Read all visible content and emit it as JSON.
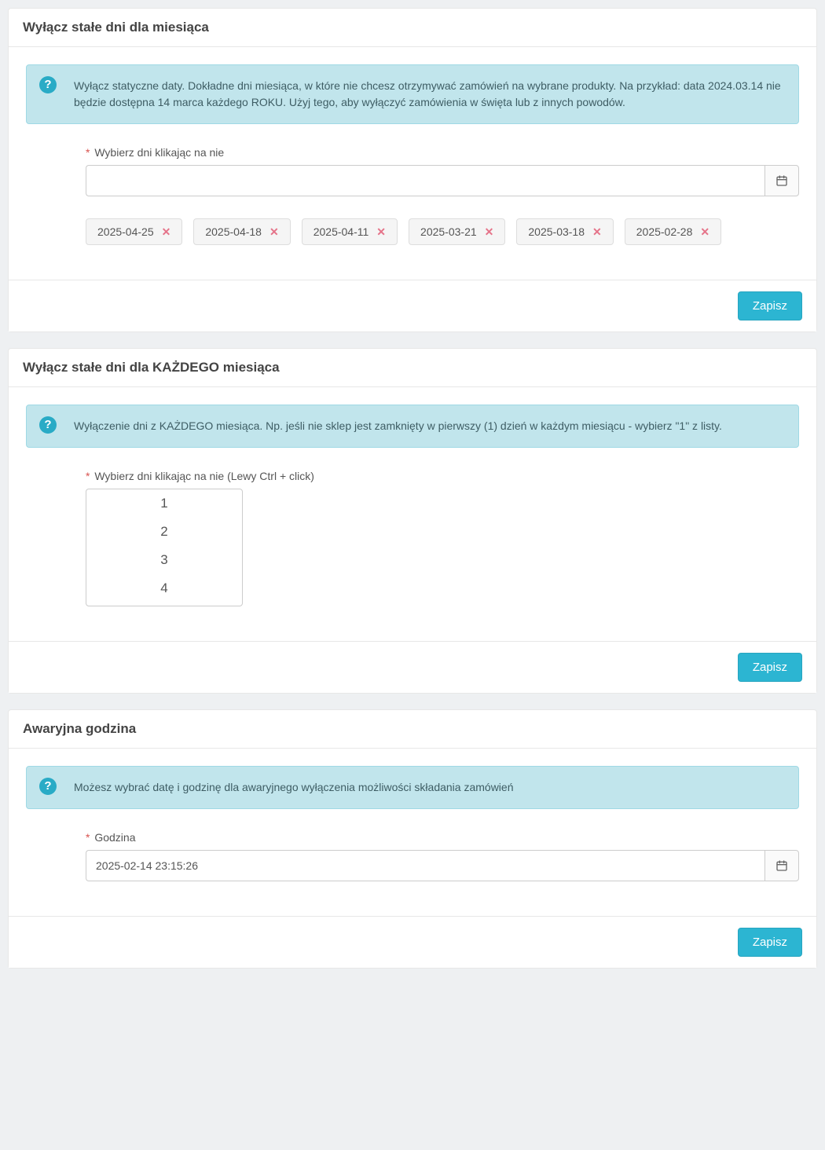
{
  "panel1": {
    "title": "Wyłącz stałe dni dla miesiąca",
    "info": "Wyłącz statyczne daty. Dokładne dni miesiąca, w które nie chcesz otrzymywać zamówień na wybrane produkty. Na przykład: data 2024.03.14 nie będzie dostępna 14 marca każdego ROKU. Użyj tego, aby wyłączyć zamówienia w święta lub z innych powodów.",
    "label": "Wybierz dni klikając na nie",
    "dates": [
      "2025-04-25",
      "2025-04-18",
      "2025-04-11",
      "2025-03-21",
      "2025-03-18",
      "2025-02-28"
    ],
    "save": "Zapisz"
  },
  "panel2": {
    "title": "Wyłącz stałe dni dla KAŻDEGO miesiąca",
    "info": "Wyłączenie dni z KAŻDEGO miesiąca. Np. jeśli nie sklep jest zamknięty w pierwszy (1) dzień w każdym miesiącu - wybierz \"1\" z listy.",
    "label": "Wybierz dni klikając na nie (Lewy Ctrl + click)",
    "options": [
      "1",
      "2",
      "3",
      "4"
    ],
    "save": "Zapisz"
  },
  "panel3": {
    "title": "Awaryjna godzina",
    "info": "Możesz wybrać datę i godzinę dla awaryjnego wyłączenia możliwości składania zamówień",
    "label": "Godzina",
    "value": "2025-02-14 23:15:26",
    "save": "Zapisz"
  },
  "icons": {
    "question": "?"
  }
}
